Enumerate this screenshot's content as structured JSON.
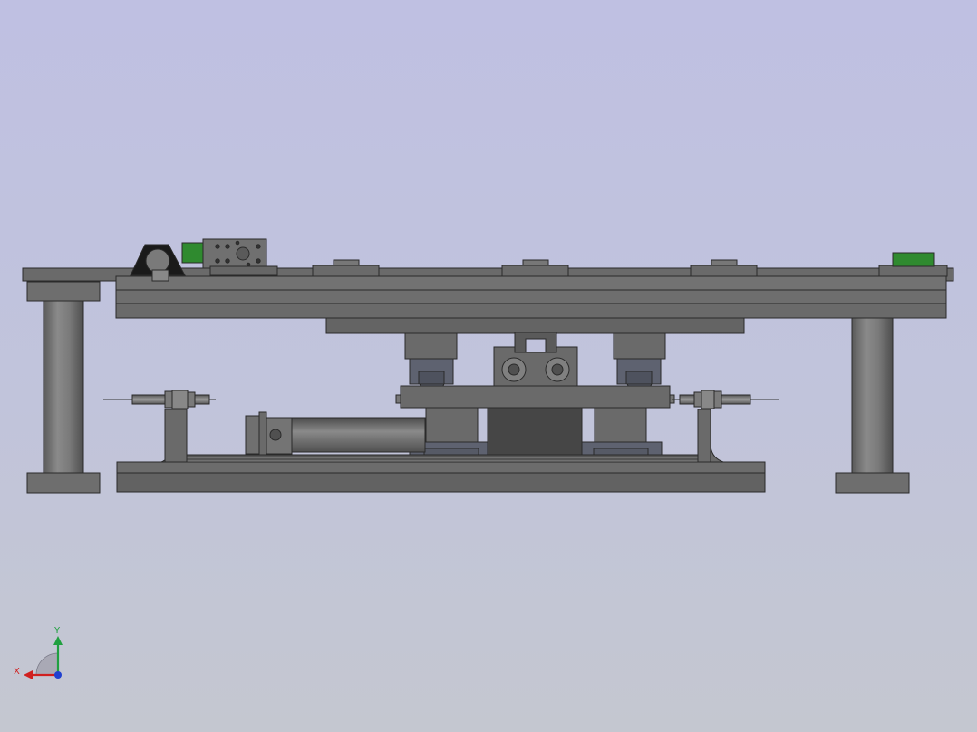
{
  "viewport": {
    "background_top": "#bfc0e2",
    "background_bottom": "#c4c7d0"
  },
  "model": {
    "part_color": "#6c6c6c",
    "part_edge_color": "#2a2a2a",
    "accent_green": "#2f8a2f",
    "bearing_block_color": "#5e6270"
  },
  "triad": {
    "x_label": "X",
    "y_label": "Y",
    "x_color": "#d02020",
    "y_color": "#20a040",
    "z_color": "#2040d0"
  }
}
